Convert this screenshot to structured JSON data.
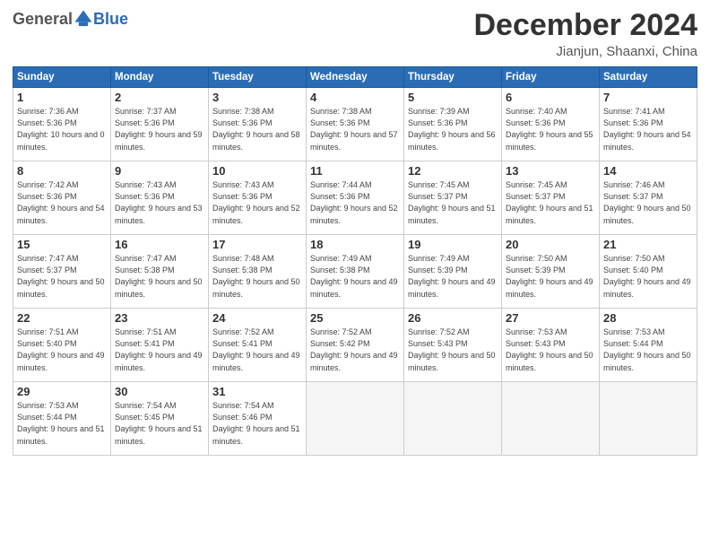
{
  "logo": {
    "general": "General",
    "blue": "Blue"
  },
  "title": "December 2024",
  "location": "Jianjun, Shaanxi, China",
  "days_of_week": [
    "Sunday",
    "Monday",
    "Tuesday",
    "Wednesday",
    "Thursday",
    "Friday",
    "Saturday"
  ],
  "weeks": [
    [
      {
        "num": "1",
        "sunrise": "7:36 AM",
        "sunset": "5:36 PM",
        "daylight": "10 hours and 0 minutes."
      },
      {
        "num": "2",
        "sunrise": "7:37 AM",
        "sunset": "5:36 PM",
        "daylight": "9 hours and 59 minutes."
      },
      {
        "num": "3",
        "sunrise": "7:38 AM",
        "sunset": "5:36 PM",
        "daylight": "9 hours and 58 minutes."
      },
      {
        "num": "4",
        "sunrise": "7:38 AM",
        "sunset": "5:36 PM",
        "daylight": "9 hours and 57 minutes."
      },
      {
        "num": "5",
        "sunrise": "7:39 AM",
        "sunset": "5:36 PM",
        "daylight": "9 hours and 56 minutes."
      },
      {
        "num": "6",
        "sunrise": "7:40 AM",
        "sunset": "5:36 PM",
        "daylight": "9 hours and 55 minutes."
      },
      {
        "num": "7",
        "sunrise": "7:41 AM",
        "sunset": "5:36 PM",
        "daylight": "9 hours and 54 minutes."
      }
    ],
    [
      {
        "num": "8",
        "sunrise": "7:42 AM",
        "sunset": "5:36 PM",
        "daylight": "9 hours and 54 minutes."
      },
      {
        "num": "9",
        "sunrise": "7:43 AM",
        "sunset": "5:36 PM",
        "daylight": "9 hours and 53 minutes."
      },
      {
        "num": "10",
        "sunrise": "7:43 AM",
        "sunset": "5:36 PM",
        "daylight": "9 hours and 52 minutes."
      },
      {
        "num": "11",
        "sunrise": "7:44 AM",
        "sunset": "5:36 PM",
        "daylight": "9 hours and 52 minutes."
      },
      {
        "num": "12",
        "sunrise": "7:45 AM",
        "sunset": "5:37 PM",
        "daylight": "9 hours and 51 minutes."
      },
      {
        "num": "13",
        "sunrise": "7:45 AM",
        "sunset": "5:37 PM",
        "daylight": "9 hours and 51 minutes."
      },
      {
        "num": "14",
        "sunrise": "7:46 AM",
        "sunset": "5:37 PM",
        "daylight": "9 hours and 50 minutes."
      }
    ],
    [
      {
        "num": "15",
        "sunrise": "7:47 AM",
        "sunset": "5:37 PM",
        "daylight": "9 hours and 50 minutes."
      },
      {
        "num": "16",
        "sunrise": "7:47 AM",
        "sunset": "5:38 PM",
        "daylight": "9 hours and 50 minutes."
      },
      {
        "num": "17",
        "sunrise": "7:48 AM",
        "sunset": "5:38 PM",
        "daylight": "9 hours and 50 minutes."
      },
      {
        "num": "18",
        "sunrise": "7:49 AM",
        "sunset": "5:38 PM",
        "daylight": "9 hours and 49 minutes."
      },
      {
        "num": "19",
        "sunrise": "7:49 AM",
        "sunset": "5:39 PM",
        "daylight": "9 hours and 49 minutes."
      },
      {
        "num": "20",
        "sunrise": "7:50 AM",
        "sunset": "5:39 PM",
        "daylight": "9 hours and 49 minutes."
      },
      {
        "num": "21",
        "sunrise": "7:50 AM",
        "sunset": "5:40 PM",
        "daylight": "9 hours and 49 minutes."
      }
    ],
    [
      {
        "num": "22",
        "sunrise": "7:51 AM",
        "sunset": "5:40 PM",
        "daylight": "9 hours and 49 minutes."
      },
      {
        "num": "23",
        "sunrise": "7:51 AM",
        "sunset": "5:41 PM",
        "daylight": "9 hours and 49 minutes."
      },
      {
        "num": "24",
        "sunrise": "7:52 AM",
        "sunset": "5:41 PM",
        "daylight": "9 hours and 49 minutes."
      },
      {
        "num": "25",
        "sunrise": "7:52 AM",
        "sunset": "5:42 PM",
        "daylight": "9 hours and 49 minutes."
      },
      {
        "num": "26",
        "sunrise": "7:52 AM",
        "sunset": "5:43 PM",
        "daylight": "9 hours and 50 minutes."
      },
      {
        "num": "27",
        "sunrise": "7:53 AM",
        "sunset": "5:43 PM",
        "daylight": "9 hours and 50 minutes."
      },
      {
        "num": "28",
        "sunrise": "7:53 AM",
        "sunset": "5:44 PM",
        "daylight": "9 hours and 50 minutes."
      }
    ],
    [
      {
        "num": "29",
        "sunrise": "7:53 AM",
        "sunset": "5:44 PM",
        "daylight": "9 hours and 51 minutes."
      },
      {
        "num": "30",
        "sunrise": "7:54 AM",
        "sunset": "5:45 PM",
        "daylight": "9 hours and 51 minutes."
      },
      {
        "num": "31",
        "sunrise": "7:54 AM",
        "sunset": "5:46 PM",
        "daylight": "9 hours and 51 minutes."
      },
      null,
      null,
      null,
      null
    ]
  ]
}
